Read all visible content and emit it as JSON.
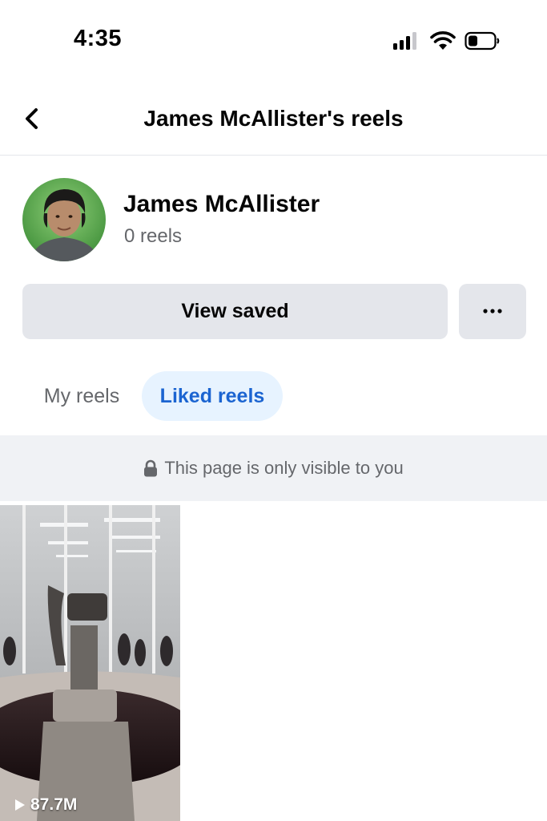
{
  "status_bar": {
    "time": "4:35"
  },
  "header": {
    "title": "James McAllister's reels",
    "back_icon": "chevron-left-icon"
  },
  "profile": {
    "name": "James McAllister",
    "reel_count": "0 reels"
  },
  "actions": {
    "view_saved_label": "View saved",
    "more_label": "•••"
  },
  "tabs": [
    {
      "label": "My reels",
      "active": false
    },
    {
      "label": "Liked reels",
      "active": true
    }
  ],
  "privacy_notice": {
    "icon": "lock-icon",
    "text": "This page is only visible to you"
  },
  "reels": [
    {
      "views": "87.7M",
      "icon": "play-icon"
    }
  ],
  "colors": {
    "accent": "#1b64d1",
    "active_tab_bg": "#e7f3ff",
    "button_bg": "#e4e6eb",
    "banner_bg": "#f0f2f5",
    "secondary_text": "#65676b"
  }
}
